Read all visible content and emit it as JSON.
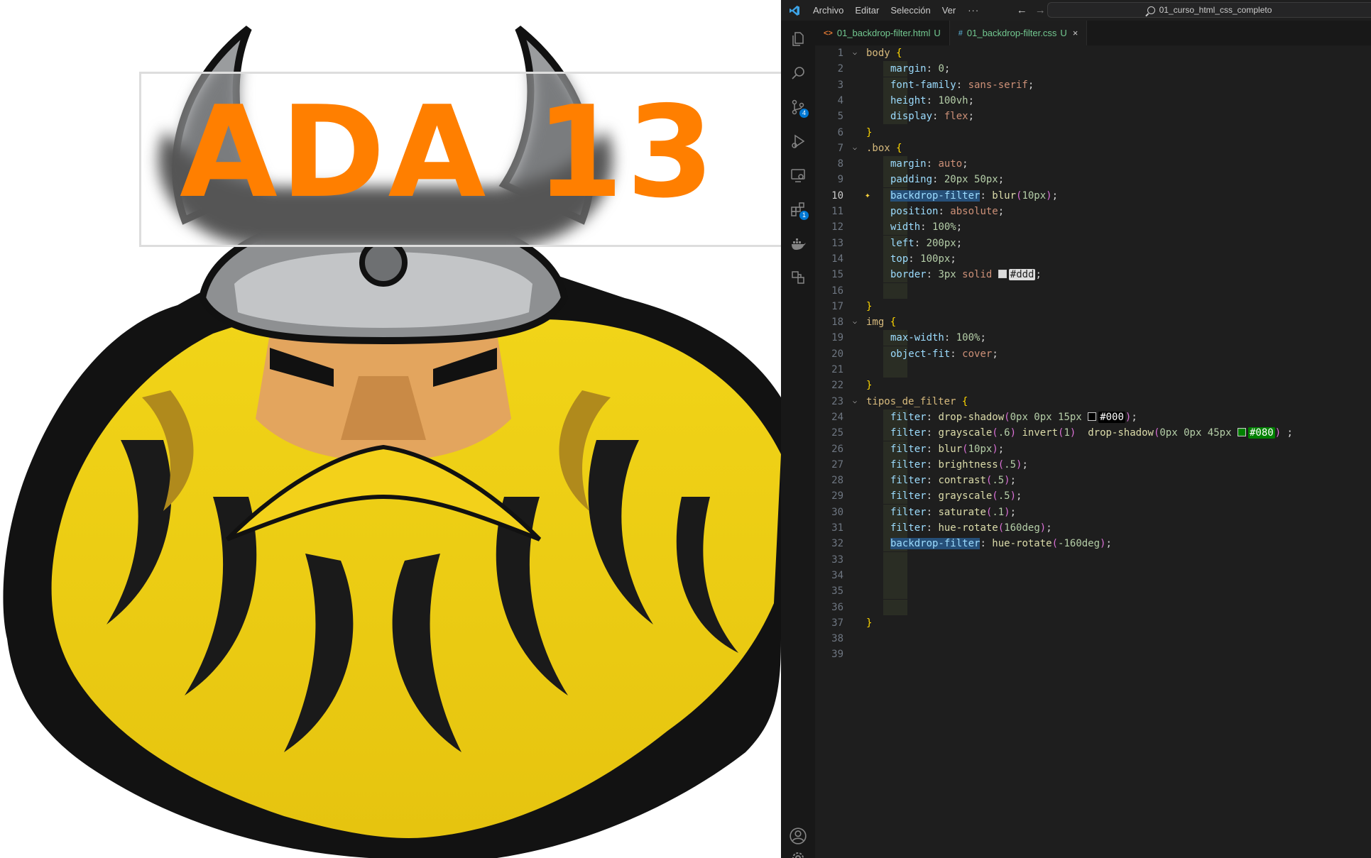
{
  "preview": {
    "logo_text": "ADA 13"
  },
  "titlebar": {
    "menus": [
      "Archivo",
      "Editar",
      "Selección",
      "Ver"
    ],
    "more": "···",
    "search": "01_curso_html_css_completo"
  },
  "activity": {
    "source_control_badge": "4",
    "extensions_badge": "1"
  },
  "tabs": [
    {
      "icon": "<>",
      "label": "01_backdrop-filter.html",
      "status": "U"
    },
    {
      "icon": "#",
      "label": "01_backdrop-filter.css",
      "status": "U",
      "close": "×"
    }
  ],
  "editor": {
    "current_line": 10,
    "lines": [
      {
        "n": "1",
        "indent": 0,
        "fold": true,
        "tokens": [
          [
            "sel",
            "body"
          ],
          [
            "txt",
            " "
          ],
          [
            "brace",
            "{"
          ]
        ]
      },
      {
        "n": "2",
        "indent": 1,
        "tokens": [
          [
            "prop",
            "margin"
          ],
          [
            "txt",
            ": "
          ],
          [
            "num",
            "0"
          ],
          [
            "txt",
            ";"
          ]
        ]
      },
      {
        "n": "3",
        "indent": 1,
        "tokens": [
          [
            "prop",
            "font-family"
          ],
          [
            "txt",
            ": "
          ],
          [
            "val",
            "sans-serif"
          ],
          [
            "txt",
            ";"
          ]
        ]
      },
      {
        "n": "4",
        "indent": 1,
        "tokens": [
          [
            "prop",
            "height"
          ],
          [
            "txt",
            ": "
          ],
          [
            "num",
            "100vh"
          ],
          [
            "txt",
            ";"
          ]
        ]
      },
      {
        "n": "5",
        "indent": 1,
        "tokens": [
          [
            "prop",
            "display"
          ],
          [
            "txt",
            ": "
          ],
          [
            "val",
            "flex"
          ],
          [
            "txt",
            ";"
          ]
        ]
      },
      {
        "n": "6",
        "indent": 0,
        "tokens": [
          [
            "brace",
            "}"
          ]
        ]
      },
      {
        "n": "7",
        "indent": 0,
        "fold": true,
        "tokens": [
          [
            "sel",
            ".box"
          ],
          [
            "txt",
            " "
          ],
          [
            "brace",
            "{"
          ]
        ]
      },
      {
        "n": "8",
        "indent": 1,
        "tokens": [
          [
            "prop",
            "margin"
          ],
          [
            "txt",
            ": "
          ],
          [
            "val",
            "auto"
          ],
          [
            "txt",
            ";"
          ]
        ]
      },
      {
        "n": "9",
        "indent": 1,
        "tokens": [
          [
            "prop",
            "padding"
          ],
          [
            "txt",
            ": "
          ],
          [
            "num",
            "20px 50px"
          ],
          [
            "txt",
            ";"
          ]
        ]
      },
      {
        "n": "10",
        "indent": 1,
        "sparkle": true,
        "tokens": [
          [
            "prophl",
            "backdrop-filter"
          ],
          [
            "txt",
            ": "
          ],
          [
            "fn",
            "blur"
          ],
          [
            "paren",
            "("
          ],
          [
            "num",
            "10px"
          ],
          [
            "paren",
            ")"
          ],
          [
            "txt",
            ";"
          ]
        ]
      },
      {
        "n": "11",
        "indent": 1,
        "tokens": [
          [
            "prop",
            "position"
          ],
          [
            "txt",
            ": "
          ],
          [
            "val",
            "absolute"
          ],
          [
            "txt",
            ";"
          ]
        ]
      },
      {
        "n": "12",
        "indent": 1,
        "tokens": [
          [
            "prop",
            "width"
          ],
          [
            "txt",
            ": "
          ],
          [
            "num",
            "100%"
          ],
          [
            "txt",
            ";"
          ]
        ]
      },
      {
        "n": "13",
        "indent": 1,
        "tokens": [
          [
            "prop",
            "left"
          ],
          [
            "txt",
            ": "
          ],
          [
            "num",
            "200px"
          ],
          [
            "txt",
            ";"
          ]
        ]
      },
      {
        "n": "14",
        "indent": 1,
        "tokens": [
          [
            "prop",
            "top"
          ],
          [
            "txt",
            ": "
          ],
          [
            "num",
            "100px"
          ],
          [
            "txt",
            ";"
          ]
        ]
      },
      {
        "n": "15",
        "indent": 1,
        "tokens": [
          [
            "prop",
            "border"
          ],
          [
            "txt",
            ": "
          ],
          [
            "num",
            "3px"
          ],
          [
            "txt",
            " "
          ],
          [
            "val",
            "solid"
          ],
          [
            "txt",
            " "
          ],
          [
            "swatch",
            "#dddddd"
          ],
          [
            "hex",
            "#ddd",
            "#dddddd",
            "#1e1e1e"
          ],
          [
            "txt",
            ";"
          ]
        ]
      },
      {
        "n": "16",
        "indent": 1,
        "tokens": []
      },
      {
        "n": "17",
        "indent": 0,
        "tokens": [
          [
            "brace",
            "}"
          ]
        ]
      },
      {
        "n": "18",
        "indent": 0,
        "fold": true,
        "tokens": [
          [
            "sel",
            "img"
          ],
          [
            "txt",
            " "
          ],
          [
            "brace",
            "{"
          ]
        ]
      },
      {
        "n": "19",
        "indent": 1,
        "tokens": [
          [
            "prop",
            "max-width"
          ],
          [
            "txt",
            ": "
          ],
          [
            "num",
            "100%"
          ],
          [
            "txt",
            ";"
          ]
        ]
      },
      {
        "n": "20",
        "indent": 1,
        "tokens": [
          [
            "prop",
            "object-fit"
          ],
          [
            "txt",
            ": "
          ],
          [
            "val",
            "cover"
          ],
          [
            "txt",
            ";"
          ]
        ]
      },
      {
        "n": "21",
        "indent": 1,
        "tokens": []
      },
      {
        "n": "22",
        "indent": 0,
        "tokens": [
          [
            "brace",
            "}"
          ]
        ]
      },
      {
        "n": "23",
        "indent": 0,
        "fold": true,
        "tokens": [
          [
            "sel",
            "tipos_de_filter"
          ],
          [
            "txt",
            " "
          ],
          [
            "brace",
            "{"
          ]
        ]
      },
      {
        "n": "24",
        "indent": 1,
        "tokens": [
          [
            "prop",
            "filter"
          ],
          [
            "txt",
            ": "
          ],
          [
            "fn",
            "drop-shadow"
          ],
          [
            "paren",
            "("
          ],
          [
            "num",
            "0px 0px 15px"
          ],
          [
            "txt",
            " "
          ],
          [
            "swatch",
            "#000000"
          ],
          [
            "hex",
            "#000",
            "#000000",
            "#ffffff"
          ],
          [
            "paren",
            ")"
          ],
          [
            "txt",
            ";"
          ]
        ]
      },
      {
        "n": "25",
        "indent": 1,
        "tokens": [
          [
            "prop",
            "filter"
          ],
          [
            "txt",
            ": "
          ],
          [
            "fn",
            "grayscale"
          ],
          [
            "paren",
            "("
          ],
          [
            "num",
            ".6"
          ],
          [
            "paren",
            ")"
          ],
          [
            "txt",
            " "
          ],
          [
            "fn",
            "invert"
          ],
          [
            "paren",
            "("
          ],
          [
            "num",
            "1"
          ],
          [
            "paren",
            ")"
          ],
          [
            "txt",
            "  "
          ],
          [
            "fn",
            "drop-shadow"
          ],
          [
            "paren",
            "("
          ],
          [
            "num",
            "0px 0px 45px"
          ],
          [
            "txt",
            " "
          ],
          [
            "swatch",
            "#008000"
          ],
          [
            "hex",
            "#080",
            "#008000",
            "#ffffff"
          ],
          [
            "paren",
            ")"
          ],
          [
            "txt",
            " ;"
          ]
        ]
      },
      {
        "n": "26",
        "indent": 1,
        "tokens": [
          [
            "prop",
            "filter"
          ],
          [
            "txt",
            ": "
          ],
          [
            "fn",
            "blur"
          ],
          [
            "paren",
            "("
          ],
          [
            "num",
            "10px"
          ],
          [
            "paren",
            ")"
          ],
          [
            "txt",
            ";"
          ]
        ]
      },
      {
        "n": "27",
        "indent": 1,
        "tokens": [
          [
            "prop",
            "filter"
          ],
          [
            "txt",
            ": "
          ],
          [
            "fn",
            "brightness"
          ],
          [
            "paren",
            "("
          ],
          [
            "num",
            ".5"
          ],
          [
            "paren",
            ")"
          ],
          [
            "txt",
            ";"
          ]
        ]
      },
      {
        "n": "28",
        "indent": 1,
        "tokens": [
          [
            "prop",
            "filter"
          ],
          [
            "txt",
            ": "
          ],
          [
            "fn",
            "contrast"
          ],
          [
            "paren",
            "("
          ],
          [
            "num",
            ".5"
          ],
          [
            "paren",
            ")"
          ],
          [
            "txt",
            ";"
          ]
        ]
      },
      {
        "n": "29",
        "indent": 1,
        "tokens": [
          [
            "prop",
            "filter"
          ],
          [
            "txt",
            ": "
          ],
          [
            "fn",
            "grayscale"
          ],
          [
            "paren",
            "("
          ],
          [
            "num",
            ".5"
          ],
          [
            "paren",
            ")"
          ],
          [
            "txt",
            ";"
          ]
        ]
      },
      {
        "n": "30",
        "indent": 1,
        "tokens": [
          [
            "prop",
            "filter"
          ],
          [
            "txt",
            ": "
          ],
          [
            "fn",
            "saturate"
          ],
          [
            "paren",
            "("
          ],
          [
            "num",
            ".1"
          ],
          [
            "paren",
            ")"
          ],
          [
            "txt",
            ";"
          ]
        ]
      },
      {
        "n": "31",
        "indent": 1,
        "tokens": [
          [
            "prop",
            "filter"
          ],
          [
            "txt",
            ": "
          ],
          [
            "fn",
            "hue-rotate"
          ],
          [
            "paren",
            "("
          ],
          [
            "num",
            "160deg"
          ],
          [
            "paren",
            ")"
          ],
          [
            "txt",
            ";"
          ]
        ]
      },
      {
        "n": "32",
        "indent": 1,
        "tokens": [
          [
            "prophl",
            "backdrop-filter"
          ],
          [
            "txt",
            ": "
          ],
          [
            "fn",
            "hue-rotate"
          ],
          [
            "paren",
            "("
          ],
          [
            "num",
            "-160deg"
          ],
          [
            "paren",
            ")"
          ],
          [
            "txt",
            ";"
          ]
        ]
      },
      {
        "n": "33",
        "indent": 1,
        "tokens": []
      },
      {
        "n": "34",
        "indent": 1,
        "tokens": []
      },
      {
        "n": "35",
        "indent": 1,
        "tokens": []
      },
      {
        "n": "36",
        "indent": 1,
        "tokens": []
      },
      {
        "n": "37",
        "indent": 0,
        "tokens": [
          [
            "brace",
            "}"
          ]
        ]
      },
      {
        "n": "38",
        "indent": 0,
        "tokens": []
      },
      {
        "n": "39",
        "indent": 0,
        "tokens": []
      }
    ]
  }
}
